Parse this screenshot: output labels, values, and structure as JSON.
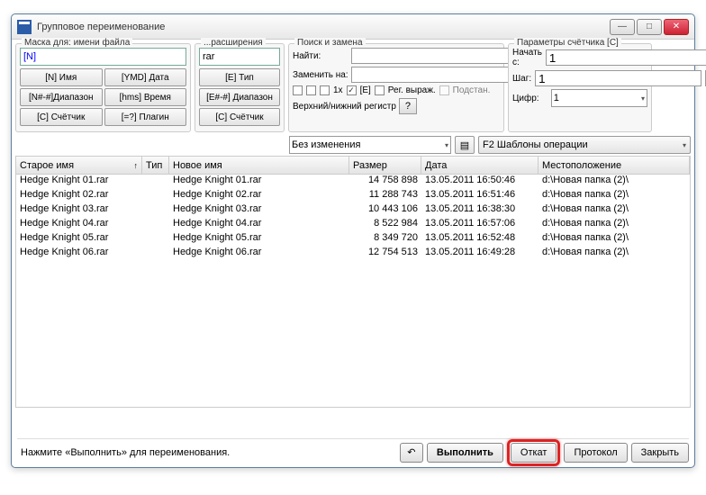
{
  "window": {
    "title": "Групповое переименование"
  },
  "groups": {
    "mask": "Маска для: имени файла",
    "ext": "...расширения",
    "search": "Поиск и замена",
    "counter": "Параметры счётчика [C]",
    "case_label": "Верхний/нижний регистр"
  },
  "mask": {
    "value": "[N]",
    "btns": [
      [
        "[N]   Имя",
        "[YMD] Дата"
      ],
      [
        "[N#-#]Диапазон",
        "[hms] Время"
      ],
      [
        "[C]   Счётчик",
        "[=?]   Плагин"
      ]
    ]
  },
  "ext": {
    "value": "rar",
    "btns": [
      "[E]   Тип",
      "[E#-#] Диапазон",
      "[C]   Счётчик"
    ]
  },
  "search": {
    "find_label": "Найти:",
    "replace_label": "Заменить на:",
    "find_value": "",
    "replace_value": "",
    "chk_1x": "1x",
    "chk_E": "[E]",
    "chk_regex": "Рег. выраж.",
    "chk_sub": "Подстан.",
    "case_value": "Без изменения"
  },
  "counter": {
    "start_label": "Начать с:",
    "start_value": "1",
    "step_label": "Шаг:",
    "step_value": "1",
    "digits_label": "Цифр:",
    "digits_value": "1",
    "f2_label": "F2 Шаблоны операции"
  },
  "columns": {
    "old": "Старое имя",
    "type": "Тип",
    "new": "Новое имя",
    "size": "Размер",
    "date": "Дата",
    "loc": "Местоположение"
  },
  "rows": [
    {
      "old": "Hedge Knight 01.rar",
      "new": "Hedge Knight 01.rar",
      "size": "14 758 898",
      "date": "13.05.2011 16:50:46",
      "loc": "d:\\Новая папка (2)\\"
    },
    {
      "old": "Hedge Knight 02.rar",
      "new": "Hedge Knight 02.rar",
      "size": "11 288 743",
      "date": "13.05.2011 16:51:46",
      "loc": "d:\\Новая папка (2)\\"
    },
    {
      "old": "Hedge Knight 03.rar",
      "new": "Hedge Knight 03.rar",
      "size": "10 443 106",
      "date": "13.05.2011 16:38:30",
      "loc": "d:\\Новая папка (2)\\"
    },
    {
      "old": "Hedge Knight 04.rar",
      "new": "Hedge Knight 04.rar",
      "size": "8 522 984",
      "date": "13.05.2011 16:57:06",
      "loc": "d:\\Новая папка (2)\\"
    },
    {
      "old": "Hedge Knight 05.rar",
      "new": "Hedge Knight 05.rar",
      "size": "8 349 720",
      "date": "13.05.2011 16:52:48",
      "loc": "d:\\Новая папка (2)\\"
    },
    {
      "old": "Hedge Knight 06.rar",
      "new": "Hedge Knight 06.rar",
      "size": "12 754 513",
      "date": "13.05.2011 16:49:28",
      "loc": "d:\\Новая папка (2)\\"
    }
  ],
  "footer": {
    "hint": "Нажмите «Выполнить» для переименования.",
    "undo_icon": "↶",
    "execute": "Выполнить",
    "rollback": "Откат",
    "protocol": "Протокол",
    "close": "Закрыть"
  },
  "icons": {
    "sort_up": "↑",
    "help": "?",
    "doc": "▤",
    "dd": "▾",
    "min": "—",
    "max": "□",
    "x": "✕"
  }
}
